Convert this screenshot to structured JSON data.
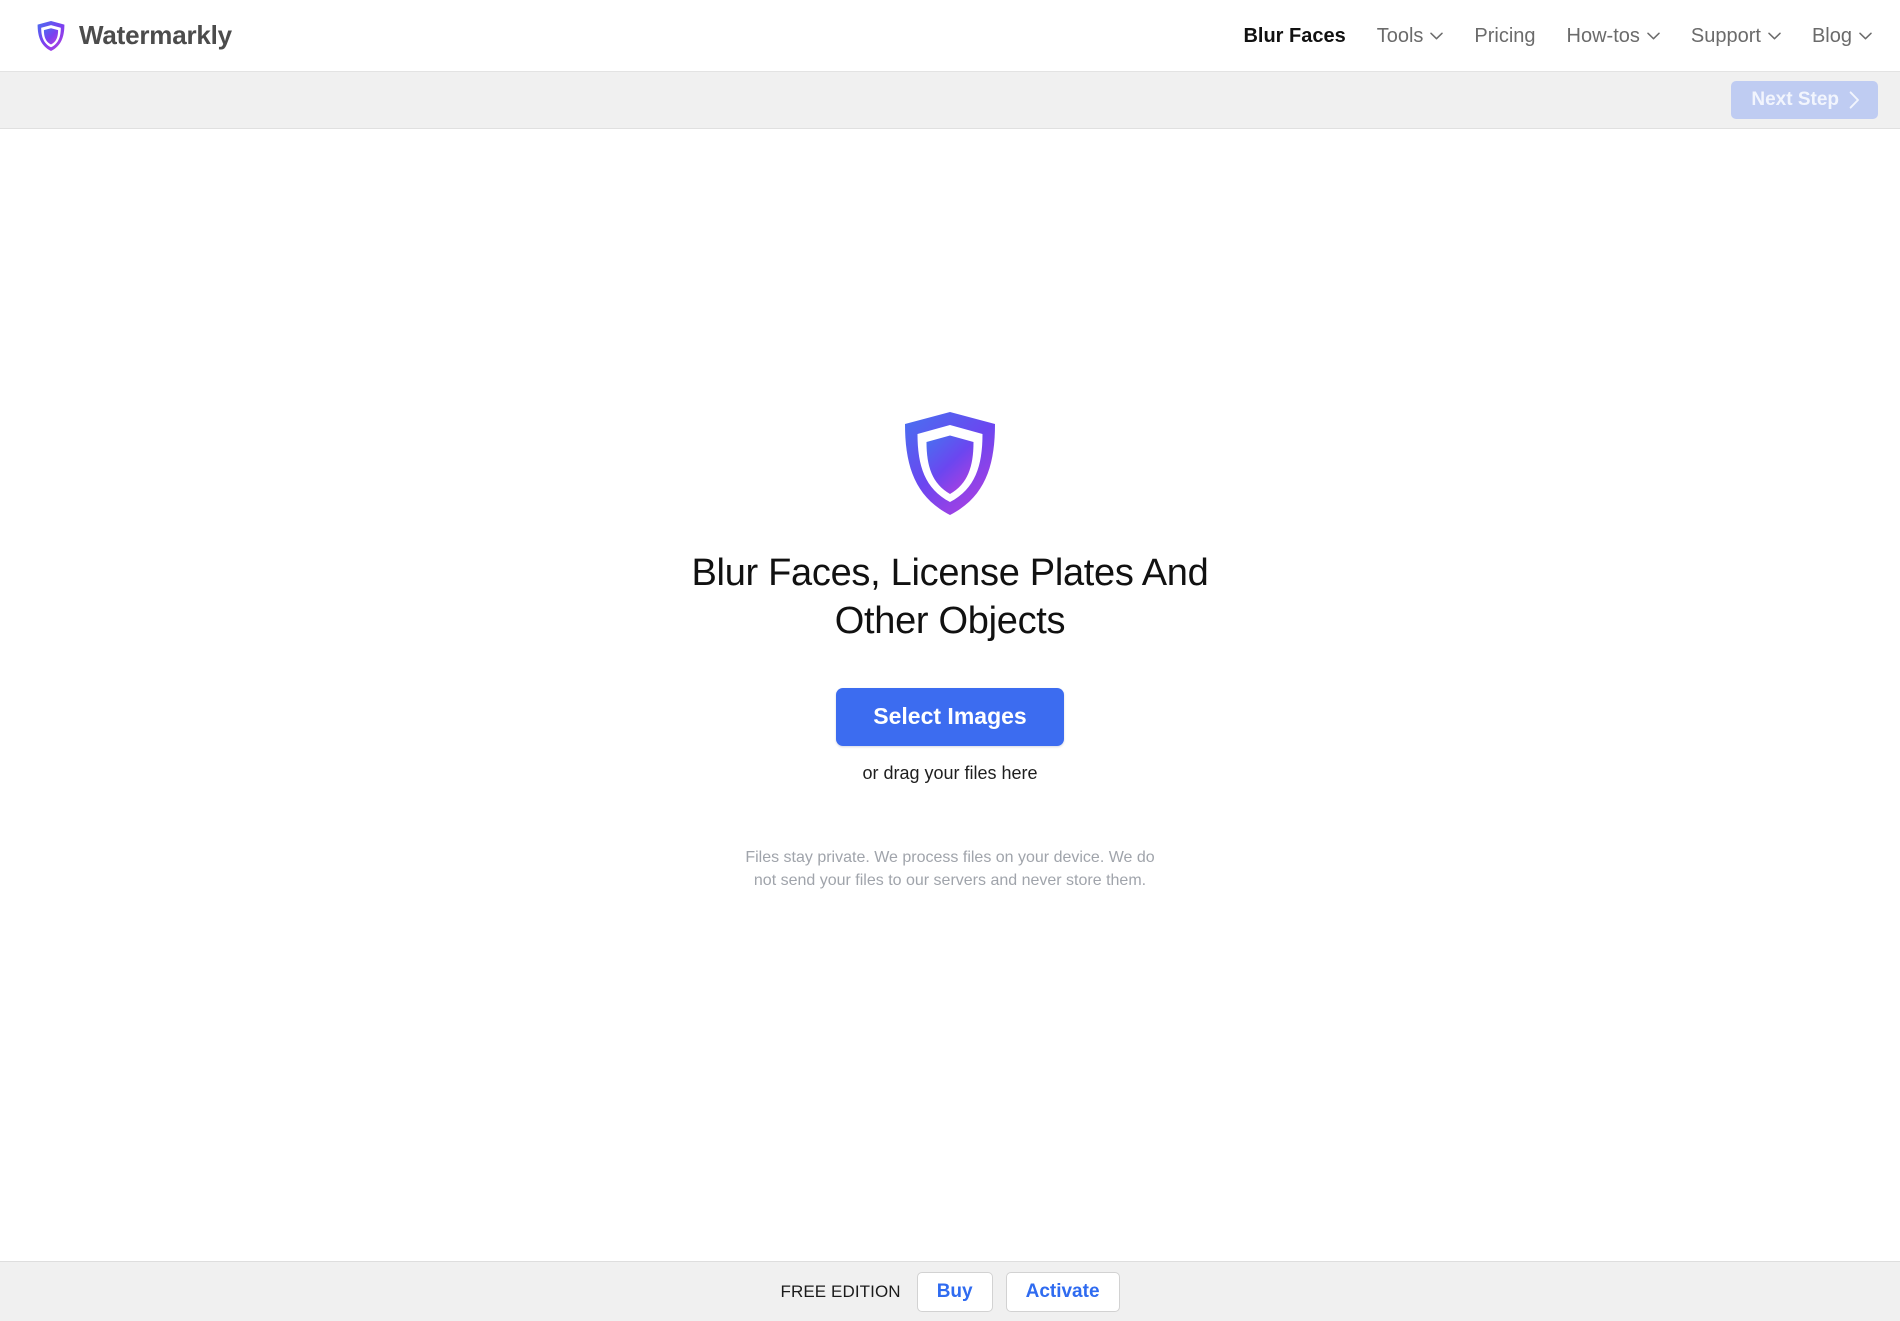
{
  "header": {
    "brand_name": "Watermarkly",
    "brand_icon": "shield-logo-icon",
    "nav": [
      {
        "label": "Blur Faces",
        "active": true,
        "caret": false
      },
      {
        "label": "Tools",
        "active": false,
        "caret": true
      },
      {
        "label": "Pricing",
        "active": false,
        "caret": false
      },
      {
        "label": "How-tos",
        "active": false,
        "caret": true
      },
      {
        "label": "Support",
        "active": false,
        "caret": true
      },
      {
        "label": "Blog",
        "active": false,
        "caret": true
      }
    ]
  },
  "toolbar": {
    "next_step_label": "Next Step",
    "next_step_icon": "chevron-right-icon",
    "next_step_disabled": true
  },
  "main": {
    "hero_icon": "shield-logo-icon",
    "headline_line1": "Blur Faces, License Plates And",
    "headline_line2": "Other Objects",
    "select_images_label": "Select Images",
    "drag_hint": "or drag your files here",
    "privacy_note": "Files stay private. We process files on your device. We do not send your files to our servers and never store them."
  },
  "footer": {
    "edition_label": "FREE EDITION",
    "buy_label": "Buy",
    "activate_label": "Activate"
  },
  "colors": {
    "accent_blue": "#3c6cf0",
    "link_blue": "#2f6bf0",
    "disabled_blue": "#bfccf2",
    "logo_gradient_start": "#4a6ef0",
    "logo_gradient_end": "#b03fe0",
    "bar_gray": "#f0f0f0",
    "muted_text": "#a0a4ab"
  }
}
